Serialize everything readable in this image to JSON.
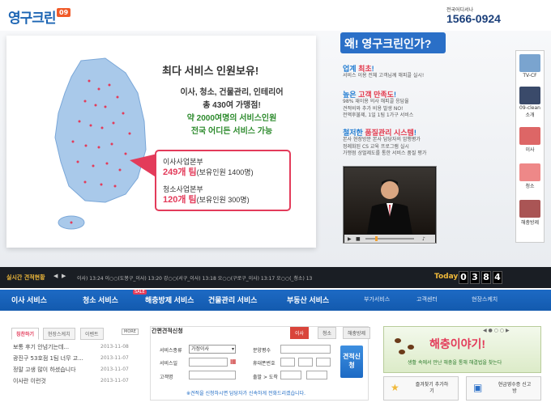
{
  "header": {
    "logo_text": "영구크린",
    "logo_badge": "09",
    "phone_label": "전국어디서나",
    "phone": "1566-0924"
  },
  "hero": {
    "headline": "최다 서비스 인원보유!",
    "lines": [
      "이사, 청소, 건물관리, 인테리어",
      "총 430여 가맹점!",
      "약 2000여명의 서비스인원",
      "전국 어디든 서비스 가능"
    ],
    "branches": [
      {
        "name": "이사사업본부",
        "count": "249개 팀",
        "detail": "(보유인원 1400명)"
      },
      {
        "name": "청소사업본부",
        "count": "120개 팀",
        "detail": "(보유인원 300명)"
      }
    ]
  },
  "why": {
    "title": "왜! 영구크린인가?",
    "features": [
      {
        "pre": "업계 ",
        "bold": "최초",
        "post": "!",
        "desc": [
          "서비스 이용 전체 고객님께 해피콜 실시!"
        ]
      },
      {
        "pre": "높은 ",
        "bold": "고객 만족도",
        "post": "!",
        "desc": [
          "98% 재이용 의사 해피콜 응답율",
          "견적비와 추가 비용 발생 NO!",
          "전액후불제, 1일 1팀 1가구 서비스"
        ]
      },
      {
        "pre": "철저한 ",
        "bold": "품질관리 시스템",
        "post": "!",
        "desc": [
          "본사 현장방문 본사 담당자의 암행평가",
          "정례화된 CS 교육 프로그램 실시",
          "가맹점 상벌제도를 통한 서비스 품질 평가"
        ]
      }
    ]
  },
  "side_menu": [
    "TV-CF",
    "09-clean 소개",
    "이사",
    "청소",
    "해충방제"
  ],
  "ticker": {
    "title": "실시간 견적현황",
    "text": "이사)      13:24 이○○(도봉구_이사)      13:20 강○○(서구_이사)      13:18 오○○(구로구_이사)      13:17 오○○(_청소)      13",
    "today_label": "Today",
    "digits": [
      "0",
      "3",
      "8",
      "4"
    ]
  },
  "nav": {
    "items": [
      "이사 서비스",
      "청소 서비스",
      "해충방제 서비스",
      "건물관리 서비스",
      "부동산 서비스"
    ],
    "sub": [
      "부가서비스",
      "고객센터",
      "현장스케치"
    ],
    "sale": "SALE"
  },
  "board": {
    "tabs": [
      "칭찬하기",
      "현장스케치",
      "이벤트"
    ],
    "more": "MORE",
    "rows": [
      {
        "title": "보통 후기 안넘기는데...",
        "date": "2013-11-08"
      },
      {
        "title": "광진구 53호점 1팀 너무 고...",
        "date": "2013-11-07"
      },
      {
        "title": "정말 고생 많이 하셨습니다",
        "date": "2013-11-07"
      },
      {
        "title": "이사란 이런것",
        "date": "2013-11-07"
      }
    ]
  },
  "estimate": {
    "title": "간편견적신청",
    "tabs": [
      "이사",
      "청소",
      "해충방제"
    ],
    "labels": {
      "kind": "서비스종류",
      "date": "서비스일",
      "name": "고객명",
      "area": "분양평수",
      "phone": "휴대폰번호",
      "route": "출발 > 도착"
    },
    "kind_value": "가정이사",
    "submit": "견적신청",
    "note": "※견적을 신청하시면 담당자가 신속하게 전화드리겠습니다."
  },
  "banner": {
    "title": "해충이야기!",
    "subtitle": "생활 속에서 만난 해충을 통해 해결법을 찾는다",
    "buttons": [
      "즐겨찾기 추가하기",
      "현금영수증 신고방"
    ]
  }
}
